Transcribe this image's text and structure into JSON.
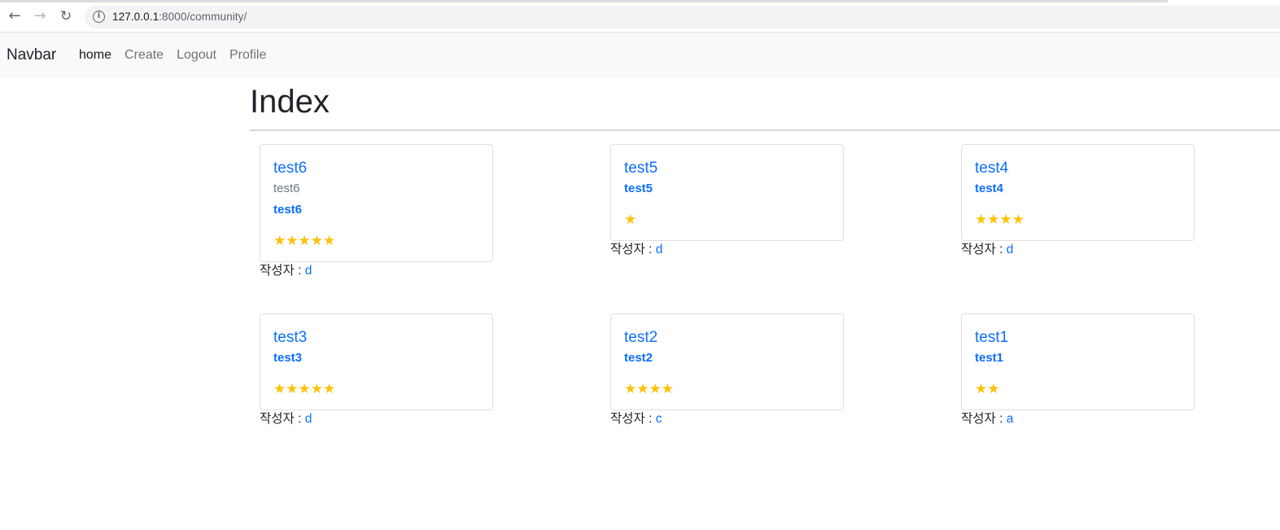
{
  "browser": {
    "back_icon": "arrow-left-icon",
    "forward_icon": "arrow-right-icon",
    "reload_icon": "reload-icon",
    "url_host": "127.0.0.1",
    "url_path": ":8000/community/"
  },
  "navbar": {
    "brand": "Navbar",
    "links": [
      {
        "label": "home",
        "active": true
      },
      {
        "label": "Create",
        "active": false
      },
      {
        "label": "Logout",
        "active": false
      },
      {
        "label": "Profile",
        "active": false
      }
    ]
  },
  "page": {
    "title": "Index",
    "author_prefix": "작성자 : "
  },
  "cards": [
    {
      "title": "test6",
      "subtitle": "test6",
      "text": "test6",
      "stars": "★★★★★",
      "rating": 5,
      "author": "d"
    },
    {
      "title": "test5",
      "subtitle": "",
      "text": "test5",
      "stars": "★",
      "rating": 1,
      "author": "d"
    },
    {
      "title": "test4",
      "subtitle": "",
      "text": "test4",
      "stars": "★★★★",
      "rating": 4,
      "author": "d"
    },
    {
      "title": "test3",
      "subtitle": "",
      "text": "test3",
      "stars": "★★★★★",
      "rating": 5,
      "author": "d"
    },
    {
      "title": "test2",
      "subtitle": "",
      "text": "test2",
      "stars": "★★★★",
      "rating": 4,
      "author": "c"
    },
    {
      "title": "test1",
      "subtitle": "",
      "text": "test1",
      "stars": "★★",
      "rating": 2,
      "author": "a"
    }
  ],
  "colors": {
    "link": "#0d6efd",
    "star": "#ffc107",
    "navbar_bg": "#f8f9fa"
  }
}
